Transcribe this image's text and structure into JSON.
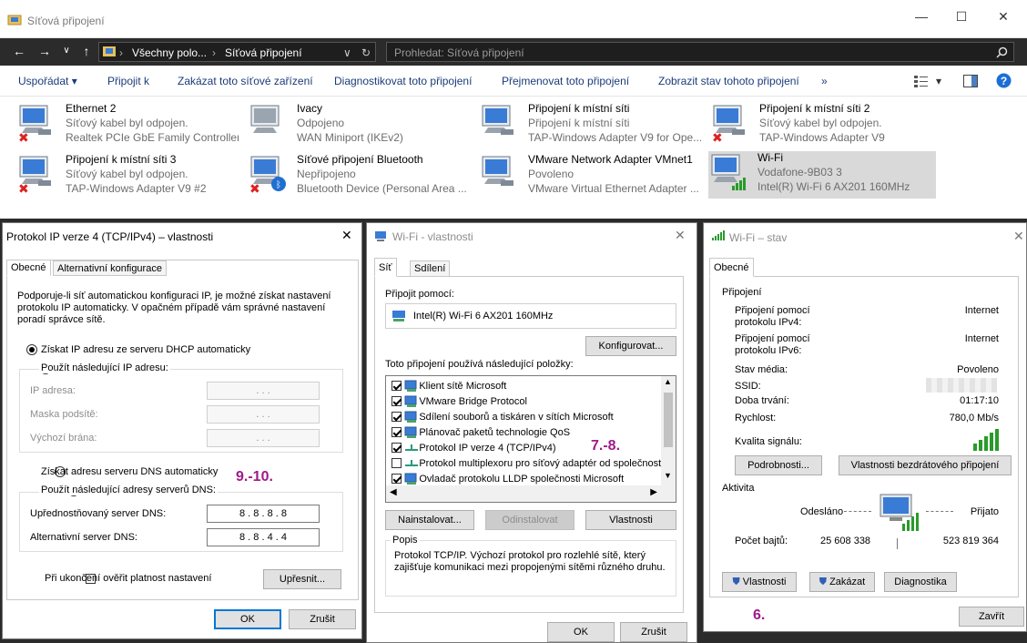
{
  "explorer": {
    "title": "Síťová připojení",
    "window_controls": {
      "minimize": "—",
      "maximize": "☐",
      "close": "✕"
    },
    "breadcrumb": [
      "Všechny polo...",
      "Síťová připojení"
    ],
    "search_placeholder": "Prohledat: Síťová připojení",
    "commands": [
      "Uspořádat ▾",
      "Připojit k",
      "Zakázat toto síťové zařízení",
      "Diagnostikovat toto připojení",
      "Přejmenovat toto připojení",
      "Zobrazit stav tohoto připojení",
      "»"
    ],
    "connections": [
      {
        "name": "Ethernet 2",
        "status": "Síťový kabel byl odpojen.",
        "device": "Realtek PCIe GbE Family Controller",
        "icon": "ethernet-disconnected-icon"
      },
      {
        "name": "Ivacy",
        "status": "Odpojeno",
        "device": "WAN Miniport (IKEv2)",
        "icon": "vpn-icon"
      },
      {
        "name": "Připojení k místní síti",
        "status": "Připojení k místní síti",
        "device": "TAP-Windows Adapter V9 for Ope...",
        "icon": "lan-icon"
      },
      {
        "name": "Připojení k místní síti 2",
        "status": "Síťový kabel byl odpojen.",
        "device": "TAP-Windows Adapter V9",
        "icon": "lan-disconnected-icon"
      },
      {
        "name": "Připojení k místní síti 3",
        "status": "Síťový kabel byl odpojen.",
        "device": "TAP-Windows Adapter V9 #2",
        "icon": "lan-disconnected-icon"
      },
      {
        "name": "Síťové připojení Bluetooth",
        "status": "Nepřipojeno",
        "device": "Bluetooth Device (Personal Area ...",
        "icon": "bluetooth-icon"
      },
      {
        "name": "VMware Network Adapter VMnet1",
        "status": "Povoleno",
        "device": "VMware Virtual Ethernet Adapter ...",
        "icon": "lan-icon"
      },
      {
        "name": "Wi-Fi",
        "status": "Vodafone-9B03 3",
        "device": "Intel(R) Wi-Fi 6 AX201 160MHz",
        "icon": "wifi-icon"
      }
    ]
  },
  "ipv4": {
    "title": "Protokol IP verze 4 (TCP/IPv4) – vlastnosti",
    "tabs": [
      "Obecné",
      "Alternativní konfigurace"
    ],
    "intro": "Podporuje-li síť automatickou konfiguraci IP, je možné získat nastavení protokolu IP automaticky. V opačném případě vám správné nastavení poradí správce sítě.",
    "auto_ip": "Získat IP adresu ze serveru DHCP automaticky",
    "manual_ip": "Použít následující IP adresu:",
    "ip_label": "IP adresa:",
    "mask_label": "Maska podsítě:",
    "gw_label": "Výchozí brána:",
    "empty_ip": ".       .       .",
    "auto_dns": "Získat adresu serveru DNS automaticky",
    "manual_dns": "Použít následující adresy serverů DNS:",
    "pref_dns_label": "Upřednostňovaný server DNS:",
    "pref_dns": "8  .  8  .  8  .  8",
    "alt_dns_label": "Alternativní server DNS:",
    "alt_dns": "8  .  8  .  4  .  4",
    "validate": "Při ukončení ověřit platnost nastavení",
    "advanced": "Upřesnit...",
    "ok": "OK",
    "cancel": "Zrušit",
    "annotation": "9.-10."
  },
  "wifiprops": {
    "title": "Wi-Fi - vlastnosti",
    "tabs": [
      "Síť",
      "Sdílení"
    ],
    "connect_using": "Připojit pomocí:",
    "adapter": "Intel(R) Wi-Fi 6 AX201 160MHz",
    "configure": "Konfigurovat...",
    "items_label": "Toto připojení používá následující položky:",
    "items": [
      {
        "label": "Klient sítě Microsoft",
        "checked": true
      },
      {
        "label": "VMware Bridge Protocol",
        "checked": true
      },
      {
        "label": "Sdílení souborů a tiskáren v sítích Microsoft",
        "checked": true
      },
      {
        "label": "Plánovač paketů technologie QoS",
        "checked": true
      },
      {
        "label": "Protokol IP verze 4 (TCP/IPv4)",
        "checked": true
      },
      {
        "label": "Protokol multiplexoru pro síťový adaptér od společnosti",
        "checked": false
      },
      {
        "label": "Ovladač protokolu LLDP společnosti Microsoft",
        "checked": true
      }
    ],
    "install": "Nainstalovat...",
    "uninstall": "Odinstalovat",
    "properties": "Vlastnosti",
    "desc_label": "Popis",
    "description": "Protokol TCP/IP. Výchozí protokol pro rozlehlé sítě, který zajišťuje komunikaci mezi propojenými sítěmi různého druhu.",
    "ok": "OK",
    "cancel": "Zrušit",
    "annotation": "7.-8."
  },
  "wifistatus": {
    "title": "Wi-Fi – stav",
    "tab": "Obecné",
    "connection_group": "Připojení",
    "ipv4_label": "Připojení pomocí protokolu IPv4:",
    "ipv4_value": "Internet",
    "ipv6_label": "Připojení pomocí protokolu IPv6:",
    "ipv6_value": "Internet",
    "media_label": "Stav média:",
    "media_value": "Povoleno",
    "ssid_label": "SSID:",
    "duration_label": "Doba trvání:",
    "duration_value": "01:17:10",
    "speed_label": "Rychlost:",
    "speed_value": "780,0 Mb/s",
    "quality_label": "Kvalita signálu:",
    "details": "Podrobnosti...",
    "wireless_props": "Vlastnosti bezdrátového připojení",
    "activity_group": "Aktivita",
    "sent_label": "Odesláno",
    "received_label": "Přijato",
    "bytes_label": "Počet bajtů:",
    "bytes_sent": "25 608 338",
    "bytes_received": "523 819 364",
    "properties": "Vlastnosti",
    "disable": "Zakázat",
    "diagnostics": "Diagnostika",
    "close": "Zavřít",
    "annotation": "6."
  }
}
